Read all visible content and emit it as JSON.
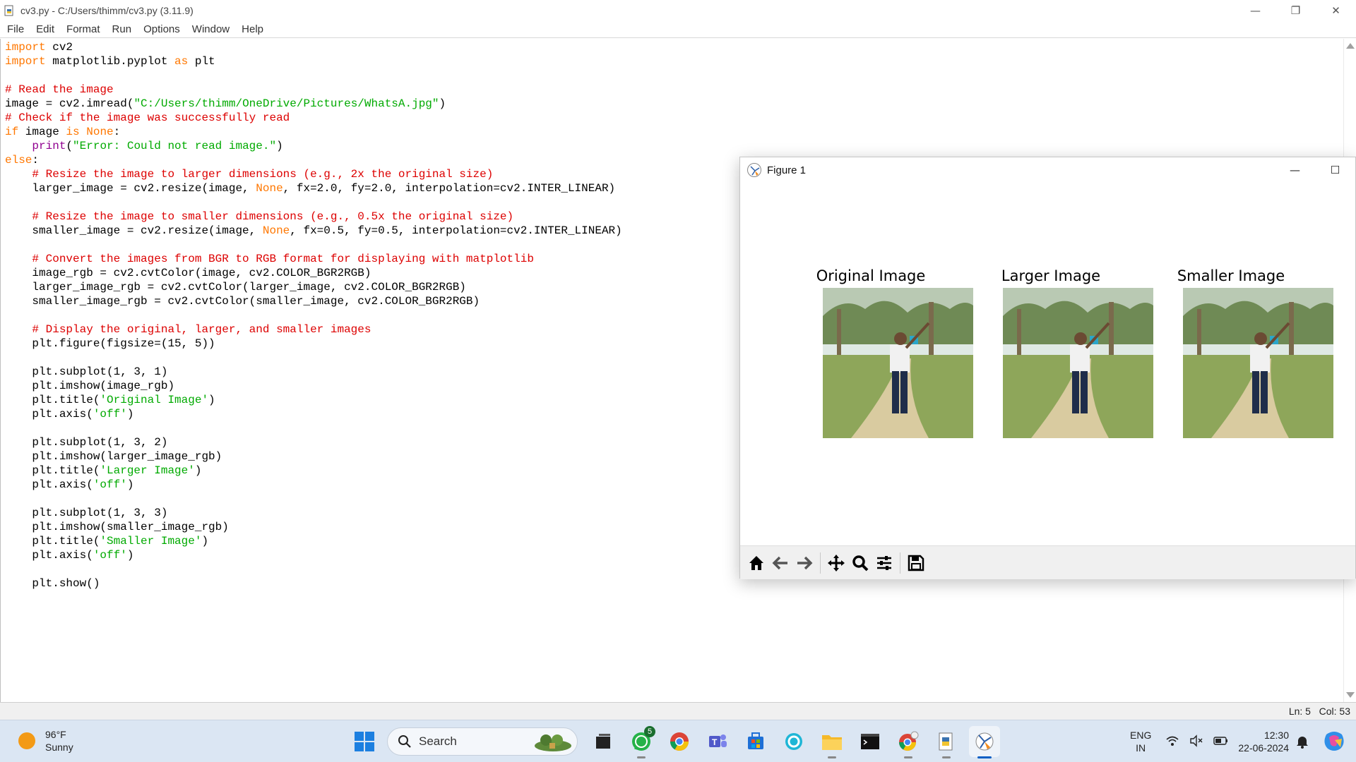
{
  "window": {
    "title": "cv3.py - C:/Users/thimm/cv3.py (3.11.9)",
    "minimize": "—",
    "maximize": "❐",
    "close": "✕"
  },
  "menu": [
    "File",
    "Edit",
    "Format",
    "Run",
    "Options",
    "Window",
    "Help"
  ],
  "status": {
    "line": "Ln: 5",
    "col": "Col: 53"
  },
  "figure": {
    "title": "Figure 1",
    "subplots": [
      {
        "title": "Original Image"
      },
      {
        "title": "Larger Image"
      },
      {
        "title": "Smaller Image"
      }
    ],
    "toolbar": [
      "home-icon",
      "back-arrow-icon",
      "forward-arrow-icon",
      "pan-icon",
      "zoom-icon",
      "configure-subplots-icon",
      "save-icon"
    ]
  },
  "taskbar": {
    "weather_temp": "96°F",
    "weather_desc": "Sunny",
    "search_label": "Search",
    "whatsapp_badge": "5",
    "lang_line1": "ENG",
    "lang_line2": "IN",
    "time": "12:30",
    "date": "22-06-2024"
  }
}
